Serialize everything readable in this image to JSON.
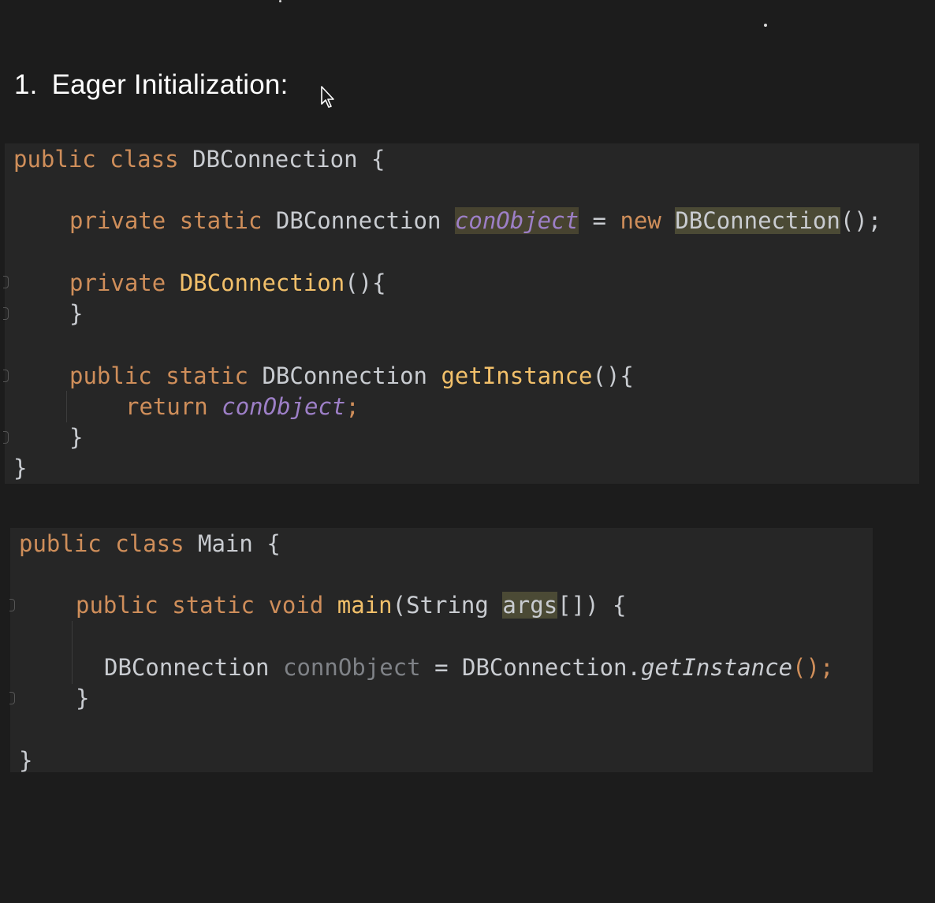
{
  "heading": {
    "number": "1.",
    "text": "Eager Initialization:"
  },
  "block1": {
    "l1": {
      "kw1": "public",
      "kw2": "class",
      "name": "DBConnection",
      "brace": "{"
    },
    "l2": {
      "kw1": "private",
      "kw2": "static",
      "type": "DBConnection",
      "field": "conObject",
      "eq": "=",
      "kw3": "new",
      "ctor": "DBConnection",
      "end": "();"
    },
    "l3": {
      "kw1": "private",
      "ctor": "DBConnection",
      "end": "(){"
    },
    "l4": {
      "brace": "}"
    },
    "l5": {
      "kw1": "public",
      "kw2": "static",
      "type": "DBConnection",
      "method": "getInstance",
      "end": "(){"
    },
    "l6": {
      "kw1": "return",
      "field": "conObject",
      "end": ";"
    },
    "l7": {
      "brace": "}"
    },
    "l8": {
      "brace": "}"
    }
  },
  "block2": {
    "l1": {
      "kw1": "public",
      "kw2": "class",
      "name": "Main",
      "brace": "{"
    },
    "l2": {
      "kw1": "public",
      "kw2": "static",
      "kw3": "void",
      "method": "main",
      "open": "(String ",
      "param": "args",
      "end": "[]) {"
    },
    "l3": {
      "type": "DBConnection",
      "var": "connObject",
      "eq": "=",
      "cls": "DBConnection.",
      "call": "getInstance",
      "end": "();"
    },
    "l4": {
      "brace": "}"
    },
    "l5": {
      "brace": "}"
    }
  }
}
